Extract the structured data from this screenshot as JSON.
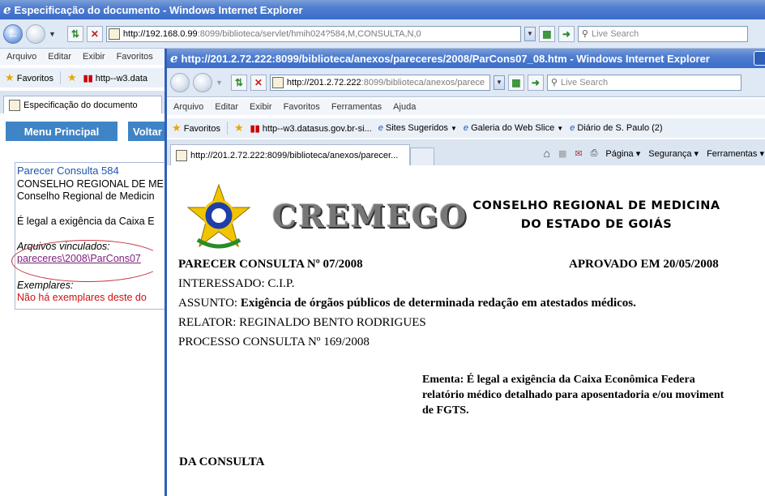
{
  "main_window": {
    "title": "Especificação do documento - Windows Internet Explorer",
    "address": {
      "host": "http://192.168.0.99",
      "rest": ":8099/biblioteca/servlet/hmih024?584,M,CONSULTA,N,0"
    },
    "search_placeholder": "Live Search",
    "menu": [
      "Arquivo",
      "Editar",
      "Exibir",
      "Favoritos"
    ],
    "favorites_label": "Favoritos",
    "fav_link": "http--w3.data",
    "tab_title": "Especificação do documento",
    "buttons": {
      "menu_principal": "Menu Principal",
      "voltar": "Voltar"
    },
    "record": {
      "title": "Parecer Consulta 584",
      "line1": "CONSELHO REGIONAL DE ME",
      "line2": "Conselho Regional de Medicin",
      "summary": "É legal a exigência da Caixa E",
      "attached_label": "Arquivos vinculados:",
      "attached_link": "pareceres\\2008\\ParCons07",
      "copies_label": "Exemplares:",
      "copies_none": "Não há exemplares deste do"
    }
  },
  "popup_window": {
    "title": "http://201.2.72.222:8099/biblioteca/anexos/pareceres/2008/ParCons07_08.htm - Windows Internet Explorer",
    "address": {
      "host": "http://201.2.72.222",
      "rest": ":8099/biblioteca/anexos/parece"
    },
    "search_placeholder": "Live Search",
    "menu": [
      "Arquivo",
      "Editar",
      "Exibir",
      "Favoritos",
      "Ferramentas",
      "Ajuda"
    ],
    "favorites_label": "Favoritos",
    "fav_links": [
      "http--w3.datasus.gov.br-si...",
      "Sites Sugeridos",
      "Galeria do Web Slice",
      "Diário de S. Paulo (2)"
    ],
    "tab_title": "http://201.2.72.222:8099/biblioteca/anexos/parecer...",
    "command_items": [
      "Página",
      "Segurança",
      "Ferramentas"
    ],
    "document": {
      "logo_text": "CREMEGO",
      "org_line1": "CONSELHO REGIONAL DE MEDICINA",
      "org_line2": "DO ESTADO DE GOIÁS",
      "parecer": "PARECER CONSULTA Nº 07/2008",
      "aprovado": "APROVADO EM 20/05/2008",
      "interessado": "INTERESSADO: C.I.P.",
      "assunto_label": "ASSUNTO:",
      "assunto_text": "Exigência de órgãos públicos de determinada redação em atestados médicos.",
      "relator": "RELATOR: REGINALDO BENTO RODRIGUES",
      "processo": "PROCESSO CONSULTA Nº 169/2008",
      "ementa_line1": "Ementa: É legal a exigência da Caixa Econômica Federa",
      "ementa_line2": "relatório médico detalhado para aposentadoria e/ou moviment",
      "ementa_line3": "de FGTS.",
      "section": "DA CONSULTA"
    }
  }
}
